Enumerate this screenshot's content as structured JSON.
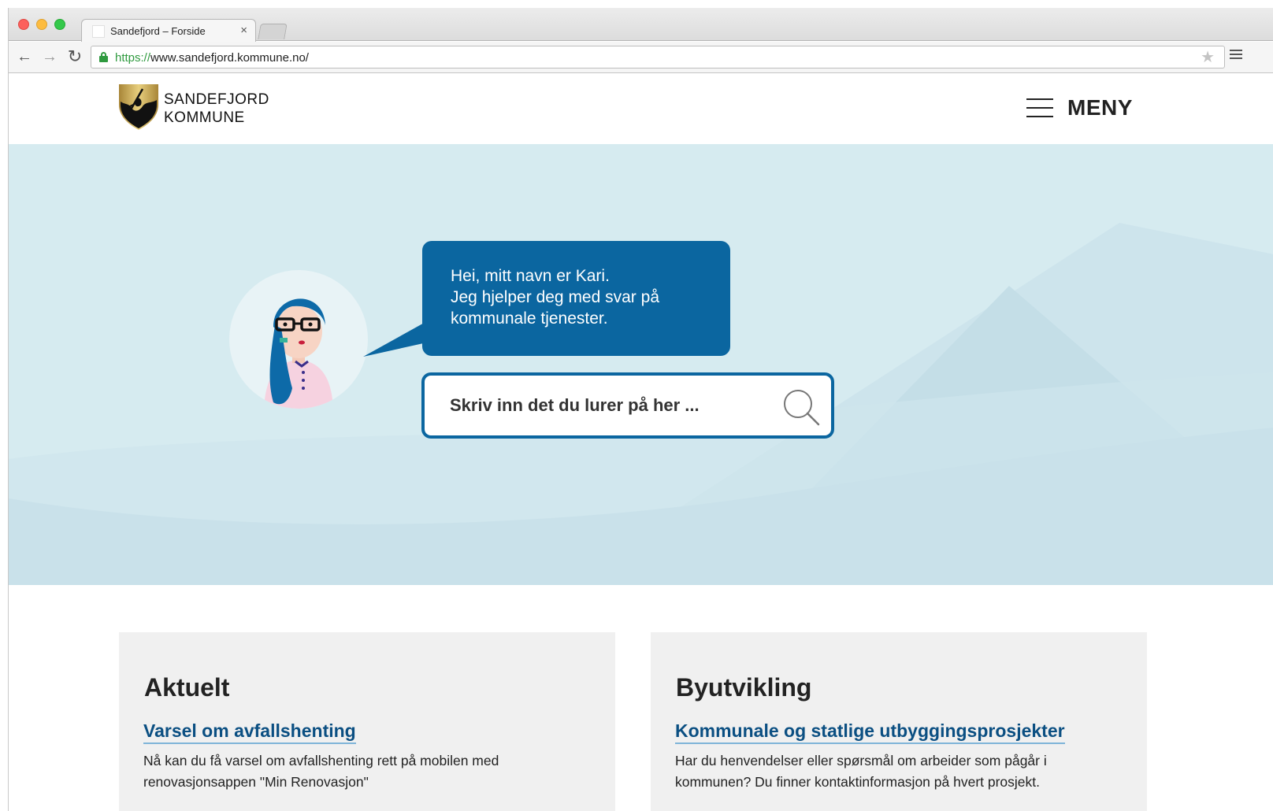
{
  "browser": {
    "tab_title": "Sandefjord – Forside",
    "tab_close": "×",
    "url_scheme": "https://",
    "url_rest": "www.sandefjord.kommune.no/"
  },
  "header": {
    "logo_line1": "SANDEFJORD",
    "logo_line2": "KOMMUNE",
    "menu_label": "MENY"
  },
  "hero": {
    "bubble_lines": [
      "Hei, mitt navn er Kari.",
      "Jeg hjelper deg med svar på",
      "kommunale tjenester."
    ],
    "search_placeholder": "Skriv inn det du lurer på her ..."
  },
  "cards": [
    {
      "heading": "Aktuelt",
      "link": "Varsel om avfallshenting",
      "text": "Nå kan du få varsel om avfallshenting rett på mobilen med renovasjonsappen \"Min Renovasjon\""
    },
    {
      "heading": "Byutvikling",
      "link": "Kommunale og statlige utbyggingsprosjekter",
      "text": "Har du henvendelser eller spørsmål om arbeider som pågår i kommunen? Du finner kontaktinformasjon på hvert prosjekt."
    }
  ],
  "colors": {
    "brand_blue": "#0b66a0",
    "hero_bg": "#d6ebf0",
    "link_blue": "#0b4f82"
  }
}
